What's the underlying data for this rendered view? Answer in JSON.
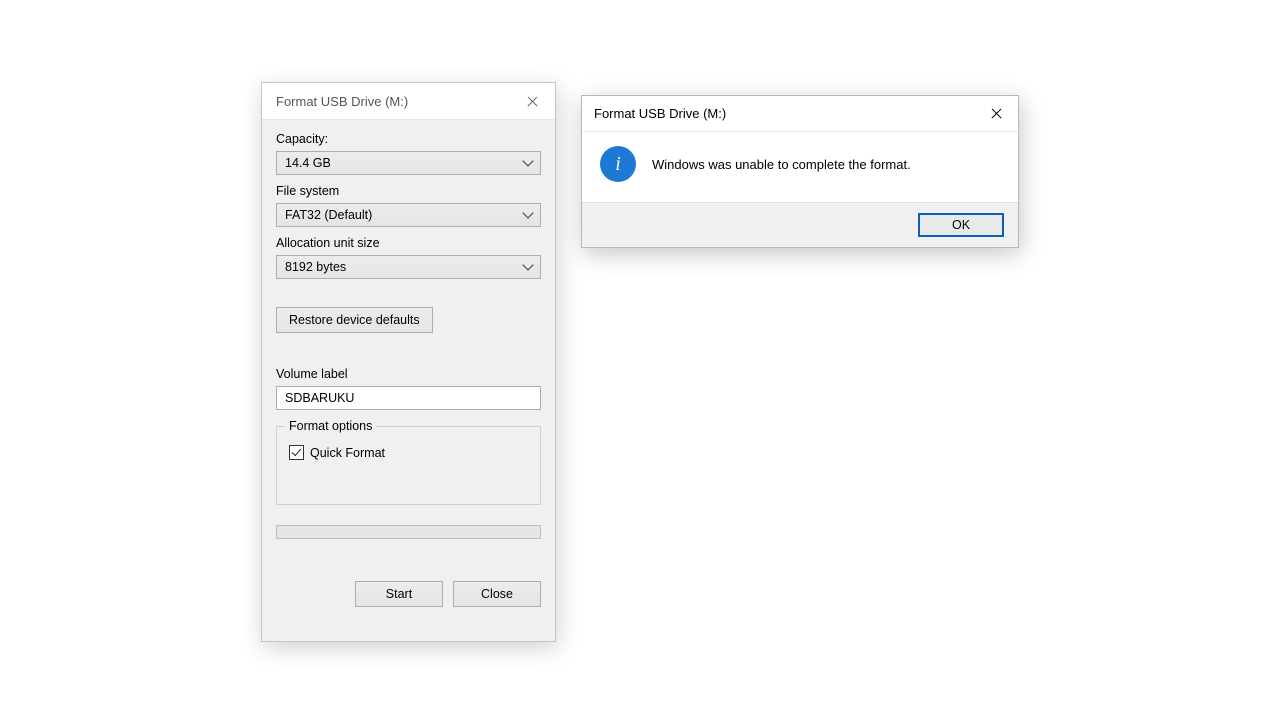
{
  "format_dialog": {
    "title": "Format USB Drive (M:)",
    "labels": {
      "capacity": "Capacity:",
      "filesystem": "File system",
      "allocation": "Allocation unit size",
      "volume_label": "Volume label",
      "format_options": "Format options"
    },
    "values": {
      "capacity": "14.4 GB",
      "filesystem": "FAT32 (Default)",
      "allocation": "8192 bytes",
      "volume_label": "SDBARUKU"
    },
    "buttons": {
      "restore": "Restore device defaults",
      "start": "Start",
      "close": "Close"
    },
    "quick_format": {
      "label": "Quick Format",
      "checked": true
    }
  },
  "error_dialog": {
    "title": "Format USB Drive (M:)",
    "message": "Windows was unable to complete the format.",
    "ok": "OK",
    "icon": "info-icon"
  }
}
